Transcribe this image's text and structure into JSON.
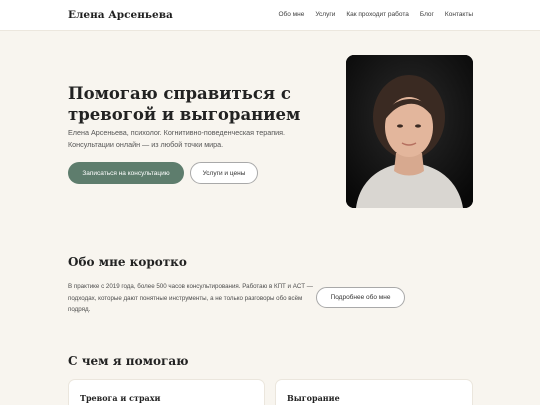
{
  "header": {
    "brand": "Елена Арсеньева",
    "nav": [
      "Обо мне",
      "Услуги",
      "Как проходит работа",
      "Блог",
      "Контакты"
    ]
  },
  "hero": {
    "title": "Помогаю справиться с тревогой и выгоранием",
    "subtitle": "Елена Арсеньева, психолог. Когнитивно-поведенческая терапия. Консультации онлайн — из любой точки мира.",
    "primary_button": "Записаться на консультацию",
    "secondary_button": "Услуги и цены"
  },
  "about": {
    "title": "Обо мне коротко",
    "text": "В практике с 2019 года, более 500 часов консультирования. Работаю в КПТ и ACT — подходах, которые дают понятные инструменты, а не только разговоры обо всём подряд.",
    "button": "Подробнее обо мне"
  },
  "help": {
    "title": "С чем я помогаю",
    "cards": [
      "Тревога и страхи",
      "Выгорание"
    ]
  },
  "colors": {
    "accent": "#5e7d6d",
    "background": "#f8f5ef"
  }
}
